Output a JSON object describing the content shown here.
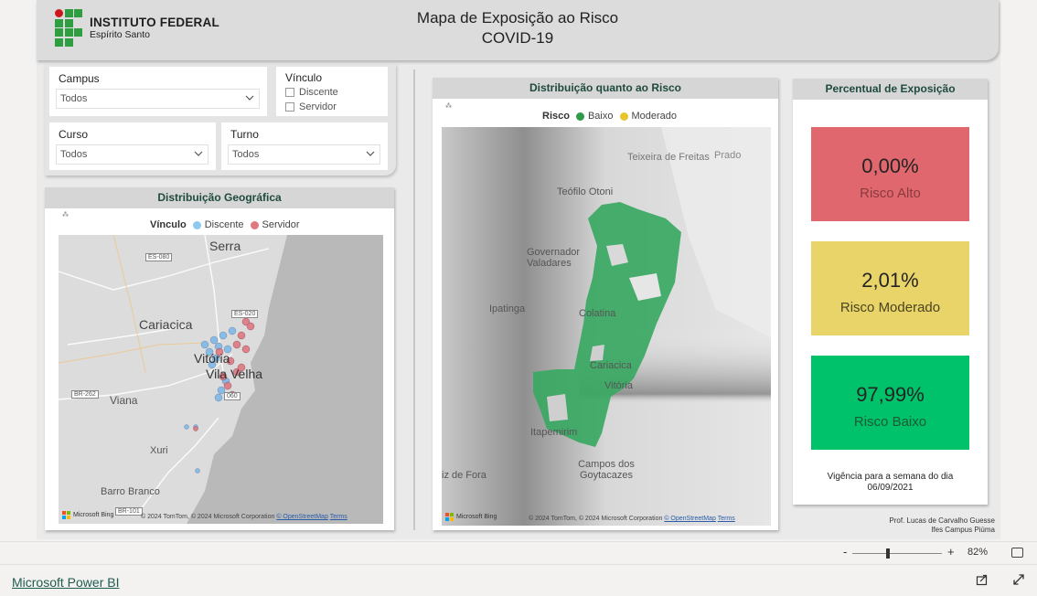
{
  "header": {
    "logo_line1": "INSTITUTO FEDERAL",
    "logo_line2": "Espírito Santo",
    "title_line1": "Mapa de Exposição ao Risco",
    "title_line2": "COVID-19"
  },
  "filters": {
    "campus": {
      "label": "Campus",
      "value": "Todos"
    },
    "vinculo": {
      "label": "Vínculo",
      "options": [
        "Discente",
        "Servidor"
      ]
    },
    "curso": {
      "label": "Curso",
      "value": "Todos"
    },
    "turno": {
      "label": "Turno",
      "value": "Todos"
    }
  },
  "geo_panel": {
    "title": "Distribuição Geográfica",
    "legend_title": "Vínculo",
    "legend": [
      {
        "label": "Discente",
        "color": "#8cc8f0"
      },
      {
        "label": "Servidor",
        "color": "#e07880"
      }
    ],
    "map_labels": [
      "Serra",
      "Cariacica",
      "Vitória",
      "Vila Velha",
      "Viana",
      "Xuri",
      "Barro Branco",
      "ES-080",
      "ES-020",
      "BR-262",
      "BR-101",
      "060"
    ],
    "footer": "© 2024 TomTom, © 2024 Microsoft Corporation",
    "osm": "© OpenStreetMap",
    "terms": "Terms",
    "ms": "Microsoft Bing"
  },
  "risk_panel": {
    "title": "Distribuição quanto ao Risco",
    "legend_title": "Risco",
    "legend": [
      {
        "label": "Baixo",
        "color": "#2e9a4a"
      },
      {
        "label": "Moderado",
        "color": "#e6c62c"
      }
    ],
    "map_labels": [
      "Teixeira de Freitas",
      "Prado",
      "Teófilo Otoni",
      "Governador Valadares",
      "Ipatinga",
      "Colatina",
      "Cariacica",
      "Vitória",
      "Itapemirim",
      "Campos dos Goytacazes",
      "iz de Fora"
    ],
    "footer": "© 2024 TomTom, © 2024 Microsoft Corporation",
    "osm": "© OpenStreetMap",
    "terms": "Terms",
    "ms": "Microsoft Bing"
  },
  "exposure": {
    "title": "Percentual de Exposição",
    "cards": [
      {
        "value": "0,00%",
        "label": "Risco Alto",
        "bg": "#e0676e",
        "label_color": "#8a3a3f"
      },
      {
        "value": "2,01%",
        "label": "Risco Moderado",
        "bg": "#e8d469",
        "label_color": "#4a4420"
      },
      {
        "value": "97,99%",
        "label": "Risco Baixo",
        "bg": "#00c26a",
        "label_color": "#1e5a35"
      }
    ],
    "validity_line1": "Vigência para a semana do dia",
    "validity_line2": "06/09/2021"
  },
  "credit": {
    "line1": "Prof. Lucas de Carvalho Guesse",
    "line2": "Ifes Campus Piúma"
  },
  "zoom": {
    "minus": "-",
    "plus": "+",
    "percent": "82%"
  },
  "footer": {
    "brand": "Microsoft Power BI"
  }
}
